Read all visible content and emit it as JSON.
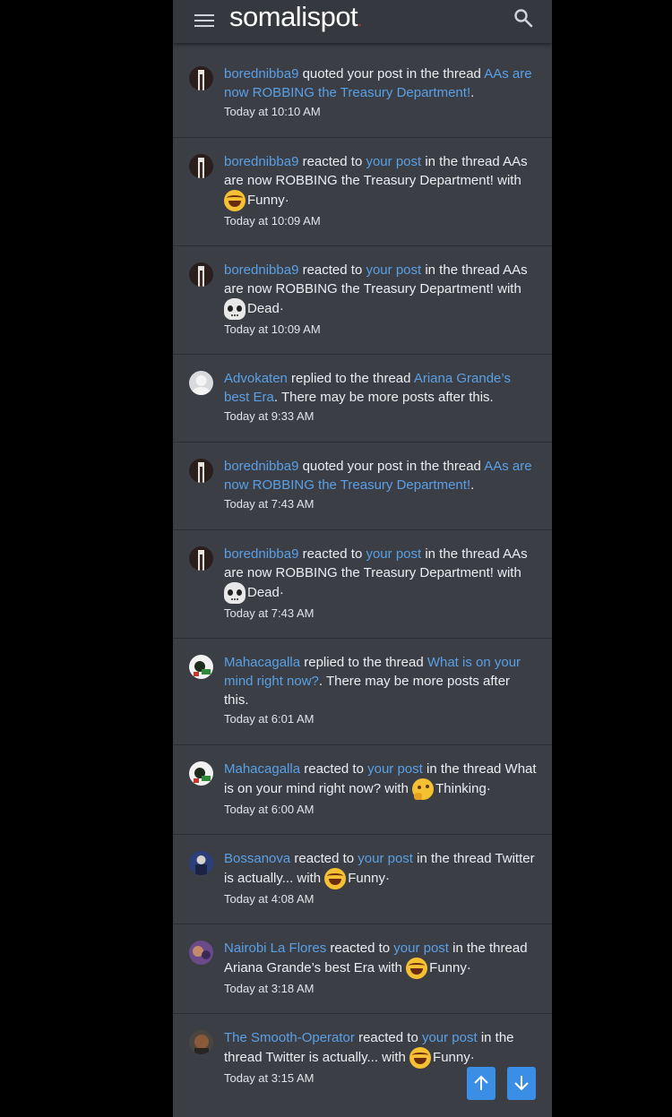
{
  "header": {
    "logo_text": "somalispot",
    "logo_dot": "."
  },
  "icons": {
    "menu": "menu-icon",
    "search": "search-icon",
    "up": "arrow-up-icon",
    "down": "arrow-down-icon"
  },
  "colors": {
    "panel": "#3b3e45",
    "link": "#5aa0e6",
    "accent_button": "#3a8ee6"
  },
  "notifications": [
    {
      "user": "borednibba9",
      "action": " quoted your post in the thread ",
      "thread": "AAs are now ROBBING the Treasury Department!",
      "tail": ".",
      "time": "Today at 10:10 AM"
    },
    {
      "user": "borednibba9",
      "action": " reacted to ",
      "post_link": "your post",
      "mid": " in the thread AAs are now ROBBING the Treasury Department! with ",
      "reaction": "Funny",
      "dot": "·",
      "time": "Today at 10:09 AM"
    },
    {
      "user": "borednibba9",
      "action": " reacted to ",
      "post_link": "your post",
      "mid": " in the thread AAs are now ROBBING the Treasury Department! with ",
      "reaction": "Dead",
      "dot": "·",
      "time": "Today at 10:09 AM"
    },
    {
      "user": "Advokaten",
      "action": " replied to the thread ",
      "thread": "Ariana Grande’s best Era",
      "tail": ". There may be more posts after this.",
      "time": "Today at 9:33 AM"
    },
    {
      "user": "borednibba9",
      "action": " quoted your post in the thread ",
      "thread": "AAs are now ROBBING the Treasury Department!",
      "tail": ".",
      "time": "Today at 7:43 AM"
    },
    {
      "user": "borednibba9",
      "action": " reacted to ",
      "post_link": "your post",
      "mid": " in the thread AAs are now ROBBING the Treasury Department! with ",
      "reaction": "Dead",
      "dot": "·",
      "time": "Today at 7:43 AM"
    },
    {
      "user": "Mahacagalla",
      "action": " replied to the thread ",
      "thread": "What is on your mind right now?",
      "tail": ". There may be more posts after this.",
      "time": "Today at 6:01 AM"
    },
    {
      "user": "Mahacagalla",
      "action": " reacted to ",
      "post_link": "your post",
      "mid": " in the thread What is on your mind right now? with ",
      "reaction": "Thinking",
      "dot": "·",
      "time": "Today at 6:00 AM"
    },
    {
      "user": "Bossanova",
      "action": " reacted to ",
      "post_link": "your post",
      "mid": " in the thread Twitter is actually... with ",
      "reaction": "Funny",
      "dot": "·",
      "time": "Today at 4:08 AM"
    },
    {
      "user": "Nairobi La Flores",
      "action": " reacted to ",
      "post_link": "your post",
      "mid": " in the thread Ariana Grande’s best Era with ",
      "reaction": "Funny",
      "dot": "·",
      "time": "Today at 3:18 AM"
    },
    {
      "user": "The Smooth-Operator",
      "action": " reacted to ",
      "post_link": "your post",
      "mid": " in the thread Twitter is actually... with ",
      "reaction": "Funny",
      "dot": "·",
      "time": "Today at 3:15 AM"
    }
  ]
}
